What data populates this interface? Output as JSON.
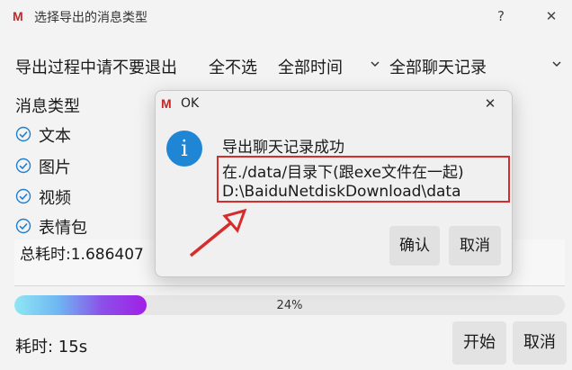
{
  "window": {
    "title": "选择导出的消息类型",
    "help": "?",
    "close": "✕"
  },
  "toolbar": {
    "status_text": "导出过程中请不要退出",
    "select_none": "全不选",
    "time_filter": "全部时间",
    "record_filter": "全部聊天记录"
  },
  "message_types": {
    "label": "消息类型",
    "items": [
      {
        "label": "文本",
        "checked": true
      },
      {
        "label": "图片",
        "checked": true
      },
      {
        "label": "视频",
        "checked": true
      },
      {
        "label": "表情包",
        "checked": true
      }
    ]
  },
  "log": {
    "text": "总耗时:1.686407"
  },
  "progress": {
    "percent": 24,
    "label": "24%"
  },
  "footer": {
    "elapsed": "耗时: 15s",
    "start_label": "开始",
    "cancel_label": "取消"
  },
  "dialog": {
    "title": "OK",
    "close": "✕",
    "icon": "info-icon",
    "message_lines": [
      "导出聊天记录成功",
      "在./data/目录下(跟exe文件在一起)",
      "D:\\BaiduNetdiskDownload\\data"
    ],
    "ok_label": "确认",
    "cancel_label": "取消"
  },
  "colors": {
    "logo": "#c0282a",
    "info_icon": "#1f86d6",
    "annotation": "#d62c2c",
    "check": "#1f7fcf"
  }
}
